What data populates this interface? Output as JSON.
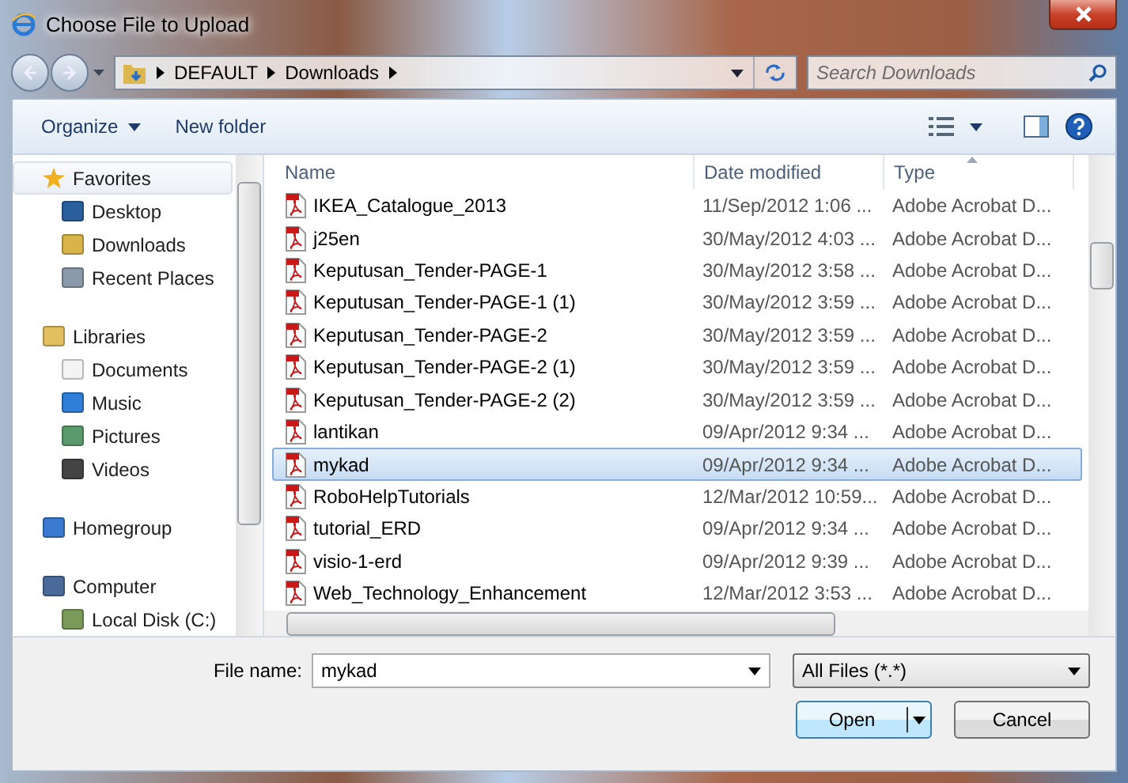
{
  "window": {
    "title": "Choose File to Upload"
  },
  "address_bar": {
    "segments": [
      "DEFAULT",
      "Downloads"
    ]
  },
  "search": {
    "placeholder": "Search Downloads"
  },
  "toolbar": {
    "organize": "Organize",
    "new_folder": "New folder"
  },
  "sidebar": {
    "groups": [
      {
        "label": "Favorites",
        "selected": true,
        "children": [
          {
            "label": "Desktop",
            "selected": false
          },
          {
            "label": "Downloads",
            "selected": false
          },
          {
            "label": "Recent Places",
            "selected": false
          }
        ]
      },
      {
        "label": "Libraries",
        "selected": false,
        "children": [
          {
            "label": "Documents",
            "selected": false
          },
          {
            "label": "Music",
            "selected": false
          },
          {
            "label": "Pictures",
            "selected": false
          },
          {
            "label": "Videos",
            "selected": false
          }
        ]
      },
      {
        "label": "Homegroup",
        "selected": false
      },
      {
        "label": "Computer",
        "selected": false,
        "children": [
          {
            "label": "Local Disk (C:)",
            "selected": false
          }
        ]
      }
    ]
  },
  "table": {
    "columns": [
      "Name",
      "Date modified",
      "Type"
    ],
    "rows": [
      {
        "name": "IKEA_Catalogue_2013",
        "date": "11/Sep/2012 1:06 ...",
        "type": "Adobe Acrobat D...",
        "selected": false
      },
      {
        "name": "j25en",
        "date": "30/May/2012 4:03 ...",
        "type": "Adobe Acrobat D...",
        "selected": false
      },
      {
        "name": "Keputusan_Tender-PAGE-1",
        "date": "30/May/2012 3:58 ...",
        "type": "Adobe Acrobat D...",
        "selected": false
      },
      {
        "name": "Keputusan_Tender-PAGE-1 (1)",
        "date": "30/May/2012 3:59 ...",
        "type": "Adobe Acrobat D...",
        "selected": false
      },
      {
        "name": "Keputusan_Tender-PAGE-2",
        "date": "30/May/2012 3:59 ...",
        "type": "Adobe Acrobat D...",
        "selected": false
      },
      {
        "name": "Keputusan_Tender-PAGE-2 (1)",
        "date": "30/May/2012 3:59 ...",
        "type": "Adobe Acrobat D...",
        "selected": false
      },
      {
        "name": "Keputusan_Tender-PAGE-2 (2)",
        "date": "30/May/2012 3:59 ...",
        "type": "Adobe Acrobat D...",
        "selected": false
      },
      {
        "name": "lantikan",
        "date": "09/Apr/2012 9:34 ...",
        "type": "Adobe Acrobat D...",
        "selected": false
      },
      {
        "name": "mykad",
        "date": "09/Apr/2012 9:34 ...",
        "type": "Adobe Acrobat D...",
        "selected": true
      },
      {
        "name": "RoboHelpTutorials",
        "date": "12/Mar/2012 10:59...",
        "type": "Adobe Acrobat D...",
        "selected": false
      },
      {
        "name": "tutorial_ERD",
        "date": "09/Apr/2012 9:34 ...",
        "type": "Adobe Acrobat D...",
        "selected": false
      },
      {
        "name": "visio-1-erd",
        "date": "09/Apr/2012 9:39 ...",
        "type": "Adobe Acrobat D...",
        "selected": false
      },
      {
        "name": "Web_Technology_Enhancement",
        "date": "12/Mar/2012 3:53 ...",
        "type": "Adobe Acrobat D...",
        "selected": false
      }
    ]
  },
  "file_name": {
    "label": "File name:",
    "value": "mykad"
  },
  "file_type": {
    "value": "All Files (*.*)"
  },
  "buttons": {
    "open": "Open",
    "cancel": "Cancel"
  }
}
